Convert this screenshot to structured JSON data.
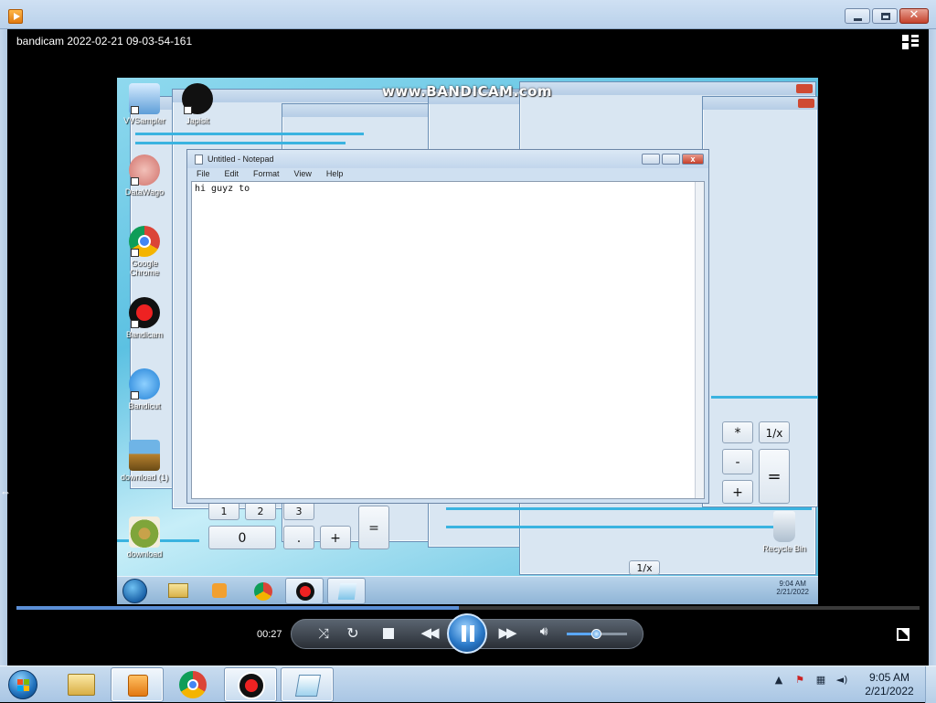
{
  "player": {
    "media_title": "bandicam 2022-02-21 09-03-54-161",
    "timecode": "00:27",
    "progress_fraction": 0.49,
    "volume_fraction": 0.5
  },
  "video": {
    "watermark": "www.BANDICAM.com",
    "desktop_icons": [
      {
        "label": "VVSampler"
      },
      {
        "label": "Japisit"
      },
      {
        "label": "DataWago"
      },
      {
        "label": "Google Chrome"
      },
      {
        "label": "Bandicam"
      },
      {
        "label": "Bandicut"
      },
      {
        "label": "download (1)"
      },
      {
        "label": "download"
      },
      {
        "label": "Recycle Bin"
      }
    ],
    "calc_keys": [
      "0",
      ".",
      "+",
      "=",
      "1",
      "2",
      "3",
      "*",
      "1/x",
      "-",
      "+",
      "=",
      "1/x"
    ],
    "notepad": {
      "title": "Untitled - Notepad",
      "menu": [
        "File",
        "Edit",
        "Format",
        "View",
        "Help"
      ],
      "content": "hi guyz to"
    },
    "inner_taskbar": {
      "time": "9:04 AM",
      "date": "2/21/2022"
    }
  },
  "taskbar": {
    "time": "9:05 AM",
    "date": "2/21/2022",
    "pinned": [
      "windows-explorer",
      "bandicam-player",
      "google-chrome",
      "bandicam",
      "notepad"
    ]
  },
  "colors": {
    "accent": "#2a79c8",
    "close_red": "#c4412b",
    "desktop_blue": "#5cc1e2"
  }
}
